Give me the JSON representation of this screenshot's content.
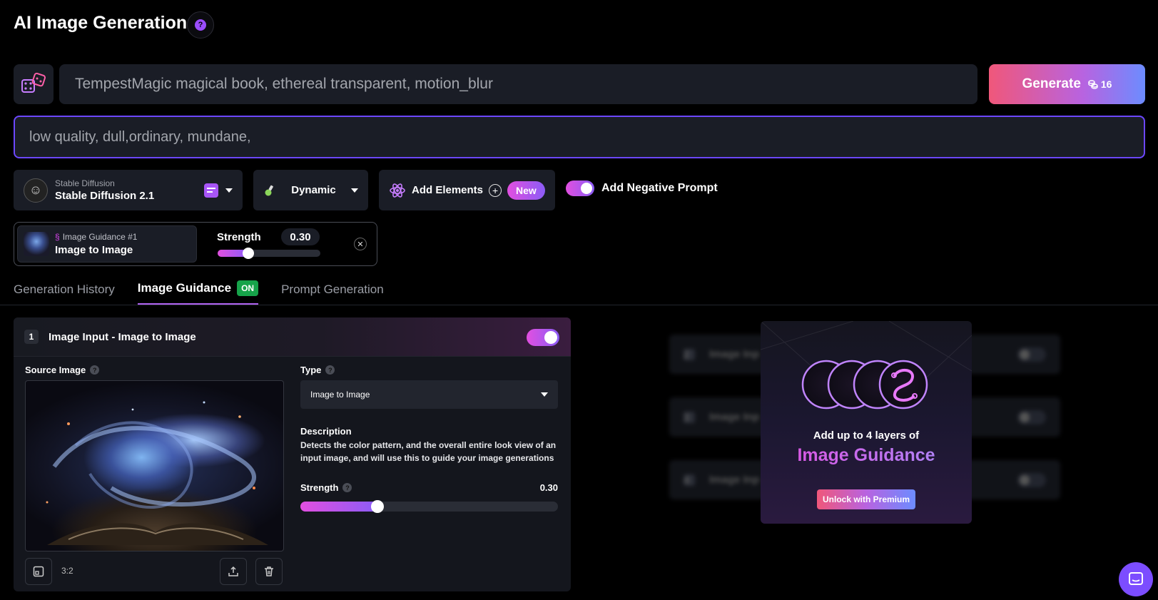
{
  "header": {
    "title": "AI Image Generation",
    "help_icon": "question-icon"
  },
  "prompt": {
    "random_icon": "dice-icon",
    "value": "TempestMagic magical book, ethereal transparent, motion_blur",
    "generate_label": "Generate",
    "cost_icon": "coins-icon",
    "cost": "16"
  },
  "negative_prompt": {
    "value": "low quality, dull,ordinary, mundane,"
  },
  "controls": {
    "model": {
      "provider": "Stable Diffusion",
      "name": "Stable Diffusion 2.1"
    },
    "style": {
      "label": "Dynamic"
    },
    "add_elements": {
      "label": "Add Elements",
      "badge": "New"
    },
    "negative_toggle": {
      "label": "Add Negative Prompt",
      "enabled": true
    }
  },
  "guidance_chip": {
    "index_label": "Image Guidance #1",
    "type": "Image to Image",
    "strength_label": "Strength",
    "strength": "0.30",
    "strength_fraction": 0.3
  },
  "tabs": [
    {
      "label": "Generation History"
    },
    {
      "label": "Image Guidance",
      "badge": "ON",
      "active": true
    },
    {
      "label": "Prompt Generation"
    }
  ],
  "image_input": {
    "number": "1",
    "title": "Image Input - Image to Image",
    "enabled": true,
    "source_label": "Source Image",
    "aspect_ratio": "3:2",
    "type_label": "Type",
    "type_value": "Image to Image",
    "description_label": "Description",
    "description": "Detects the color pattern, and the overall entire look view of an input image, and will use this to guide your image generations",
    "strength_label": "Strength",
    "strength": "0.30",
    "strength_fraction": 0.3
  },
  "locked_rows": [
    {
      "number": "2",
      "label": "Image Inp"
    },
    {
      "number": "3",
      "label": "Image Inp"
    },
    {
      "number": "4",
      "label": "Image Inp"
    }
  ],
  "premium": {
    "subtitle": "Add up to 4 layers of",
    "title": "Image Guidance",
    "button": "Unlock with Premium"
  },
  "colors": {
    "accent": "#b063f0",
    "generate_start": "#f0577a",
    "generate_end": "#6c8cff",
    "on_badge": "#16a34a"
  }
}
